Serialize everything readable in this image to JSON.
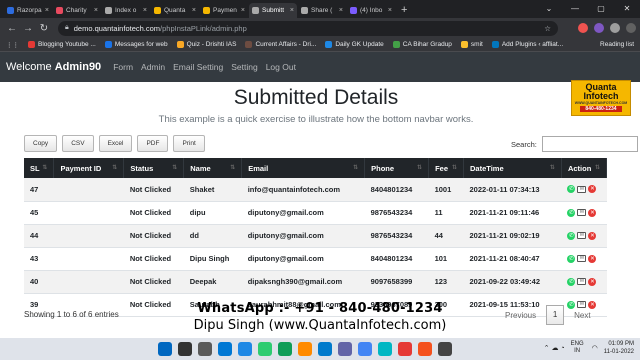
{
  "browser": {
    "tabs": [
      {
        "label": "Razorpa",
        "color": "#2d6cdf",
        "active": false
      },
      {
        "label": "Charity",
        "color": "#e84a5f",
        "active": false
      },
      {
        "label": "Index o",
        "color": "#aaaaaa",
        "active": false
      },
      {
        "label": "Quanta",
        "color": "#f5b700",
        "active": false
      },
      {
        "label": "Paymen",
        "color": "#f5b700",
        "active": false
      },
      {
        "label": "Submitt",
        "color": "#aaaaaa",
        "active": true
      },
      {
        "label": "Share (",
        "color": "#aaaaaa",
        "active": false
      },
      {
        "label": "(4) Inbo",
        "color": "#7b5cff",
        "active": false
      }
    ],
    "url_host": "demo.quantainfotech.com",
    "url_path": "/phpInstaPLink/admin.php",
    "bookmarks": [
      {
        "label": "Blogging Youtube ...",
        "color": "#e53935"
      },
      {
        "label": "Messages for web",
        "color": "#1a73e8"
      },
      {
        "label": "Quiz - Drishti IAS",
        "color": "#f9a825"
      },
      {
        "label": "Current Affairs - Dri...",
        "color": "#6d4c41"
      },
      {
        "label": "Daily GK Update",
        "color": "#1e88e5"
      },
      {
        "label": "CA Bihar Gradup",
        "color": "#43a047"
      },
      {
        "label": "smit",
        "color": "#fbc02d"
      },
      {
        "label": "Add Plugins ‹ affliat...",
        "color": "#0277bd"
      }
    ],
    "reading_list": "Reading list"
  },
  "nav": {
    "welcome": "Welcome",
    "user": "Admin90",
    "links": [
      "Form",
      "Admin",
      "Email Setting",
      "Setting",
      "Log Out"
    ]
  },
  "logo": {
    "line1": "Quanta",
    "line2": "Infotech",
    "line3": "WWW.QUANTAINFOTECH.COM",
    "line4": "840-480-1234"
  },
  "page": {
    "title": "Submitted Details",
    "subtitle": "This example is a quick exercise to illustrate how the bottom navbar works."
  },
  "toolbar": {
    "buttons": [
      "Copy",
      "CSV",
      "Excel",
      "PDF",
      "Print"
    ],
    "search_label": "Search:"
  },
  "table": {
    "headers": [
      "SL",
      "Payment ID",
      "Status",
      "Name",
      "Email",
      "Phone",
      "Fee",
      "DateTime",
      "Action"
    ],
    "rows": [
      [
        "47",
        "",
        "Not Clicked",
        "Shaket",
        "info@quantainfotech.com",
        "8404801234",
        "1001",
        "2022-01-11 07:34:13"
      ],
      [
        "45",
        "",
        "Not Clicked",
        "dipu",
        "diputony@gmail.com",
        "9876543234",
        "11",
        "2021-11-21 09:11:46"
      ],
      [
        "44",
        "",
        "Not Clicked",
        "dd",
        "diputony@gmail.com",
        "9876543234",
        "44",
        "2021-11-21 09:02:19"
      ],
      [
        "43",
        "",
        "Not Clicked",
        "Dipu Singh",
        "diputony@gmail.com",
        "8404801234",
        "101",
        "2021-11-21 08:40:47"
      ],
      [
        "40",
        "",
        "Not Clicked",
        "Deepak",
        "dipaksngh390@gmail.com",
        "9097658399",
        "123",
        "2021-09-22 03:49:42"
      ],
      [
        "39",
        "",
        "Not Clicked",
        "Saurabh",
        "saurabhmit88@gmail.com",
        "9335967089",
        "300",
        "2021-09-15 11:53:10"
      ]
    ]
  },
  "footer": {
    "info": "Showing 1 to 6 of 6 entries",
    "previous": "Previous",
    "page": "1",
    "next": "Next"
  },
  "banner": {
    "line1": "WhatsApp :- +91 - 840-480-1234",
    "line2": "Dipu Singh (www.QuantaInfotech.com)"
  },
  "taskbar": {
    "lang1": "ENG",
    "lang2": "IN",
    "time": "01:09 PM",
    "date": "11-01-2022",
    "icons": [
      "#0067c0",
      "#333333",
      "#5a5a5a",
      "#0078d4",
      "#1e88e5",
      "#2ecc71",
      "#0f9d58",
      "#ff8a00",
      "#007acc",
      "#6264a7",
      "#4285f4",
      "#00b7c3",
      "#e53935",
      "#f4511e",
      "#444444"
    ]
  }
}
